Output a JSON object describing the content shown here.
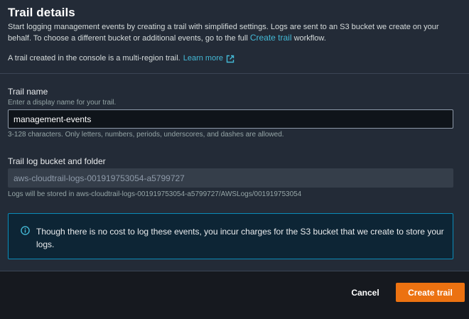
{
  "trail_details": {
    "title": "Trail details",
    "desc_part1": "Start logging management events by creating a trail with simplified settings. Logs are sent to an S3 bucket we create on your behalf. To choose a different bucket or additional events, go to the full ",
    "create_trail_link": "Create trail",
    "desc_part2": " workflow.",
    "multi_region_text": "A trail created in the console is a multi-region trail.",
    "learn_more": "Learn more"
  },
  "trail_name": {
    "label": "Trail name",
    "hint": "Enter a display name for your trail.",
    "value": "management-events",
    "constraint": "3-128 characters. Only letters, numbers, periods, underscores, and dashes are allowed."
  },
  "bucket": {
    "label": "Trail log bucket and folder",
    "value": "aws-cloudtrail-logs-001919753054-a5799727",
    "hint": "Logs will be stored in aws-cloudtrail-logs-001919753054-a5799727/AWSLogs/001919753054"
  },
  "info": {
    "text": "Though there is no cost to log these events, you incur charges for the S3 bucket that we create to store your logs.",
    "icon": "info-icon"
  },
  "actions": {
    "cancel": "Cancel",
    "create": "Create trail"
  },
  "colors": {
    "accent_link": "#44b9d6",
    "primary_button": "#ec7211",
    "info_border": "#0a8bb8"
  }
}
